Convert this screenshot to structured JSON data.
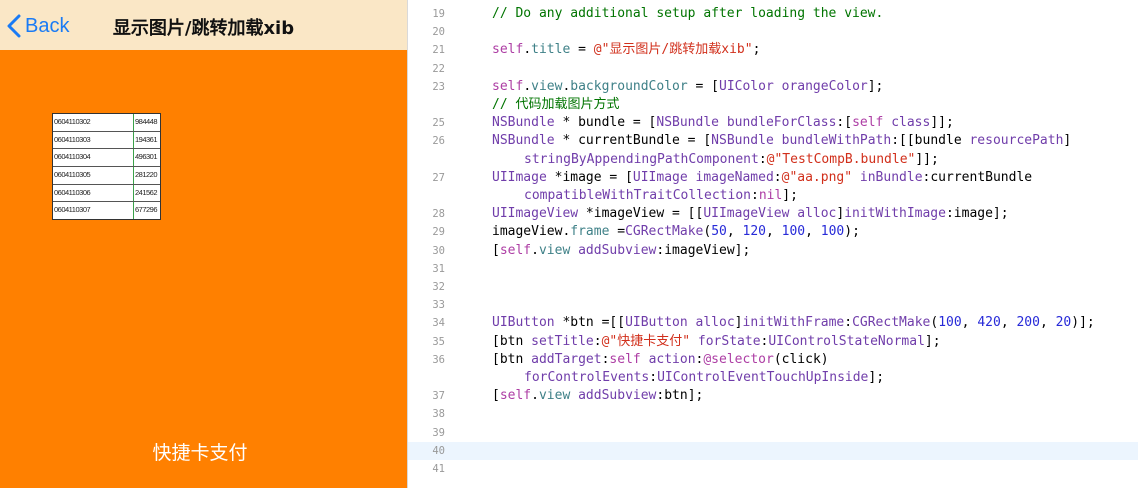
{
  "simulator": {
    "nav": {
      "back_label": "Back",
      "title": "显示图片/跳转加载xib"
    },
    "image_table": [
      [
        "0604110302",
        "984448"
      ],
      [
        "0604110303",
        "194361"
      ],
      [
        "0604110304",
        "496301"
      ],
      [
        "0604110305",
        "281220"
      ],
      [
        "0604110306",
        "241562"
      ],
      [
        "0604110307",
        "677296"
      ]
    ],
    "pay_button_label": "快捷卡支付"
  },
  "editor": {
    "current_line": "40",
    "lines": [
      {
        "num": "19",
        "segments": [
          [
            "cmt",
            "// Do any additional setup after loading the view."
          ]
        ]
      },
      {
        "num": "20",
        "segments": []
      },
      {
        "num": "21",
        "segments": [
          [
            "kw",
            "self"
          ],
          [
            "",
            "."
          ],
          [
            "meth",
            "title"
          ],
          [
            "",
            " = "
          ],
          [
            "str",
            "@\"显示图片/跳转加载xib\""
          ],
          [
            "",
            ";"
          ]
        ]
      },
      {
        "num": "22",
        "segments": []
      },
      {
        "num": "23",
        "segments": [
          [
            "kw",
            "self"
          ],
          [
            "",
            "."
          ],
          [
            "meth",
            "view"
          ],
          [
            "",
            "."
          ],
          [
            "meth",
            "backgroundColor"
          ],
          [
            "",
            " = ["
          ],
          [
            "cls",
            "UIColor"
          ],
          [
            "",
            " "
          ],
          [
            "cls",
            "orangeColor"
          ],
          [
            "",
            "];"
          ]
        ]
      },
      {
        "num": "",
        "segments": [
          [
            "cmt",
            "// 代码加载图片方式"
          ]
        ]
      },
      {
        "num": "25",
        "segments": [
          [
            "cls",
            "NSBundle"
          ],
          [
            "",
            " * bundle = ["
          ],
          [
            "cls",
            "NSBundle"
          ],
          [
            "",
            " "
          ],
          [
            "cls",
            "bundleForClass"
          ],
          [
            "",
            ":["
          ],
          [
            "kw",
            "self"
          ],
          [
            "",
            " "
          ],
          [
            "cls",
            "class"
          ],
          [
            "",
            "]];"
          ]
        ]
      },
      {
        "num": "26",
        "segments": [
          [
            "cls",
            "NSBundle"
          ],
          [
            "",
            " * currentBundle = ["
          ],
          [
            "cls",
            "NSBundle"
          ],
          [
            "",
            " "
          ],
          [
            "cls",
            "bundleWithPath"
          ],
          [
            "",
            ":[[bundle "
          ],
          [
            "cls",
            "resourcePath"
          ],
          [
            "",
            "]"
          ]
        ]
      },
      {
        "num": "",
        "wrap": true,
        "segments": [
          [
            "cls",
            "stringByAppendingPathComponent"
          ],
          [
            "",
            ":"
          ],
          [
            "str",
            "@\"TestCompB.bundle\""
          ],
          [
            "",
            "]];"
          ]
        ]
      },
      {
        "num": "27",
        "segments": [
          [
            "cls",
            "UIImage"
          ],
          [
            "",
            " *image = ["
          ],
          [
            "cls",
            "UIImage"
          ],
          [
            "",
            " "
          ],
          [
            "cls",
            "imageNamed"
          ],
          [
            "",
            ":"
          ],
          [
            "str",
            "@\"aa.png\""
          ],
          [
            "",
            " "
          ],
          [
            "cls",
            "inBundle"
          ],
          [
            "",
            ":currentBundle"
          ]
        ]
      },
      {
        "num": "",
        "wrap": true,
        "segments": [
          [
            "cls",
            "compatibleWithTraitCollection"
          ],
          [
            "",
            ":"
          ],
          [
            "kw",
            "nil"
          ],
          [
            "",
            "];"
          ]
        ]
      },
      {
        "num": "28",
        "segments": [
          [
            "cls",
            "UIImageView"
          ],
          [
            "",
            " *imageView = [["
          ],
          [
            "cls",
            "UIImageView"
          ],
          [
            "",
            " "
          ],
          [
            "cls",
            "alloc"
          ],
          [
            "",
            "]"
          ],
          [
            "cls",
            "initWithImage"
          ],
          [
            "",
            ":image];"
          ]
        ]
      },
      {
        "num": "29",
        "segments": [
          [
            "",
            "imageView."
          ],
          [
            "meth",
            "frame"
          ],
          [
            "",
            " ="
          ],
          [
            "cls",
            "CGRectMake"
          ],
          [
            "",
            "("
          ],
          [
            "num",
            "50"
          ],
          [
            "",
            ", "
          ],
          [
            "num",
            "120"
          ],
          [
            "",
            ", "
          ],
          [
            "num",
            "100"
          ],
          [
            "",
            ", "
          ],
          [
            "num",
            "100"
          ],
          [
            "",
            ");"
          ]
        ]
      },
      {
        "num": "30",
        "segments": [
          [
            "",
            "["
          ],
          [
            "kw",
            "self"
          ],
          [
            "",
            "."
          ],
          [
            "meth",
            "view"
          ],
          [
            "",
            " "
          ],
          [
            "cls",
            "addSubview"
          ],
          [
            "",
            ":imageView];"
          ]
        ]
      },
      {
        "num": "31",
        "segments": []
      },
      {
        "num": "32",
        "segments": []
      },
      {
        "num": "33",
        "segments": []
      },
      {
        "num": "34",
        "segments": [
          [
            "cls",
            "UIButton"
          ],
          [
            "",
            " *btn =[["
          ],
          [
            "cls",
            "UIButton"
          ],
          [
            "",
            " "
          ],
          [
            "cls",
            "alloc"
          ],
          [
            "",
            "]"
          ],
          [
            "cls",
            "initWithFrame"
          ],
          [
            "",
            ":"
          ],
          [
            "cls",
            "CGRectMake"
          ],
          [
            "",
            "("
          ],
          [
            "num",
            "100"
          ],
          [
            "",
            ", "
          ],
          [
            "num",
            "420"
          ],
          [
            "",
            ", "
          ],
          [
            "num",
            "200"
          ],
          [
            "",
            ", "
          ],
          [
            "num",
            "20"
          ],
          [
            "",
            ")];"
          ]
        ]
      },
      {
        "num": "35",
        "segments": [
          [
            "",
            "[btn "
          ],
          [
            "cls",
            "setTitle"
          ],
          [
            "",
            ":"
          ],
          [
            "str",
            "@\"快捷卡支付\""
          ],
          [
            "",
            " "
          ],
          [
            "cls",
            "forState"
          ],
          [
            "",
            ":"
          ],
          [
            "cls",
            "UIControlStateNormal"
          ],
          [
            "",
            "];"
          ]
        ]
      },
      {
        "num": "36",
        "segments": [
          [
            "",
            "[btn "
          ],
          [
            "cls",
            "addTarget"
          ],
          [
            "",
            ":"
          ],
          [
            "kw",
            "self"
          ],
          [
            "",
            " "
          ],
          [
            "cls",
            "action"
          ],
          [
            "",
            ":"
          ],
          [
            "kw",
            "@selector"
          ],
          [
            "",
            "(click)"
          ]
        ]
      },
      {
        "num": "",
        "wrap": true,
        "segments": [
          [
            "cls",
            "forControlEvents"
          ],
          [
            "",
            ":"
          ],
          [
            "cls",
            "UIControlEventTouchUpInside"
          ],
          [
            "",
            "];"
          ]
        ]
      },
      {
        "num": "37",
        "segments": [
          [
            "",
            "["
          ],
          [
            "kw",
            "self"
          ],
          [
            "",
            "."
          ],
          [
            "meth",
            "view"
          ],
          [
            "",
            " "
          ],
          [
            "cls",
            "addSubview"
          ],
          [
            "",
            ":btn];"
          ]
        ]
      },
      {
        "num": "38",
        "segments": []
      },
      {
        "num": "39",
        "segments": []
      },
      {
        "num": "40",
        "segments": []
      },
      {
        "num": "41",
        "segments": []
      }
    ]
  }
}
